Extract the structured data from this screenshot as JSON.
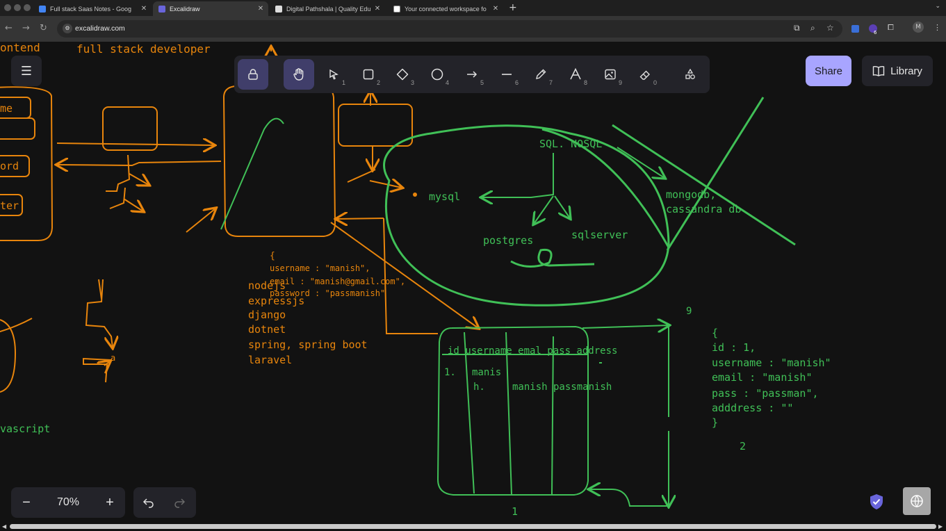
{
  "browser": {
    "tabs": [
      {
        "title": "Full stack Saas Notes - Goog",
        "active": false,
        "favicon_color": "#4285f4"
      },
      {
        "title": "Excalidraw",
        "active": true,
        "favicon_color": "#6965db"
      },
      {
        "title": "Digital Pathshala | Quality Edu",
        "active": false,
        "favicon_color": "#dddddd"
      },
      {
        "title": "Your connected workspace fo",
        "active": false,
        "favicon_color": "#ffffff"
      }
    ],
    "url": "excalidraw.com",
    "profile_initial": "M",
    "extension_badge": "6"
  },
  "app": {
    "menu_icon": "hamburger-icon",
    "tools": [
      {
        "name": "lock",
        "icon": "lock-icon",
        "shortcut": ""
      },
      {
        "name": "hand",
        "icon": "hand-icon",
        "shortcut": ""
      },
      {
        "name": "selection",
        "icon": "pointer-icon",
        "shortcut": "1"
      },
      {
        "name": "rectangle",
        "icon": "square-icon",
        "shortcut": "2"
      },
      {
        "name": "diamond",
        "icon": "diamond-icon",
        "shortcut": "3"
      },
      {
        "name": "ellipse",
        "icon": "circle-icon",
        "shortcut": "4"
      },
      {
        "name": "arrow",
        "icon": "arrow-icon",
        "shortcut": "5"
      },
      {
        "name": "line",
        "icon": "line-icon",
        "shortcut": "6"
      },
      {
        "name": "draw",
        "icon": "pencil-icon",
        "shortcut": "7"
      },
      {
        "name": "text",
        "icon": "text-icon",
        "shortcut": "8"
      },
      {
        "name": "image",
        "icon": "image-icon",
        "shortcut": "9"
      },
      {
        "name": "eraser",
        "icon": "eraser-icon",
        "shortcut": "0"
      },
      {
        "name": "more",
        "icon": "shapes-icon",
        "shortcut": ""
      }
    ],
    "share_label": "Share",
    "library_label": "Library",
    "zoom": {
      "minus": "−",
      "value": "70%",
      "plus": "+"
    }
  },
  "canvas": {
    "orange_color": "#e8850c",
    "green_color": "#40c057",
    "orange_texts": {
      "full_stack": "full stack developer",
      "frontend_partial": "ontend",
      "me_partial": "me",
      "ord_partial": "ord",
      "ter_partial": "ter",
      "json_open": "{",
      "json_username": "username : \"manish\",",
      "json_email": "email : \"manish@gmail.com\",",
      "json_password": "password : \"passmanish\"",
      "nodejs": "nodejs",
      "expressjs": "expressjs",
      "django": "django",
      "dotnet": "dotnet",
      "spring": "spring, spring boot",
      "laravel": "laravel",
      "small_a": "a"
    },
    "green_texts": {
      "sql_nosql": "SQL.  NOSQL",
      "mysql": "mysql",
      "postgres": "postgres",
      "sqlserver": "sqlserver",
      "mongodb": "mongodb,",
      "cassandra": "cassandra db",
      "table_headers": "id  username emal  pass    address",
      "row_num": "1.",
      "row_user1": "manis",
      "row_user2": "h.",
      "row_rest": "manish passmanish",
      "under_table": "1",
      "json2_open": "{",
      "json2_id": "id : 1,",
      "json2_username": "username : \"manish\"",
      "json2_email": "email : \"manish\"",
      "json2_pass": "pass : \"passman\",",
      "json2_address": "adddress : \"\"",
      "json2_close": "}",
      "json2_label": "2",
      "nine_mark": "9",
      "javascript_partial": "vascript"
    }
  }
}
